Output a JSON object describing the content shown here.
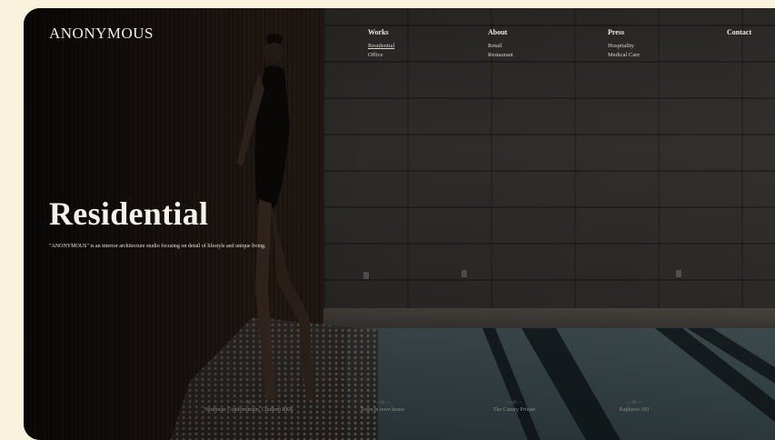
{
  "header": {
    "logo": "ANONYMOUS",
    "nav": [
      {
        "heading": "Works",
        "links": [
          "Residential",
          "Office"
        ],
        "active": 0
      },
      {
        "heading": "About",
        "links": [
          "Retail",
          "Restaurant"
        ]
      },
      {
        "heading": "Press",
        "links": [
          "Hospitality",
          "Medical Care"
        ]
      },
      {
        "heading": "Contact",
        "links": []
      }
    ]
  },
  "hero": {
    "title": "Residential",
    "description": "\"ANONYMOUS\" is an interior architecture studio focusing on detail of lifestyle and unique living."
  },
  "projects": [
    {
      "num": "— 01 —",
      "name": "Neuhouse Condominium, Chidlom BKK"
    },
    {
      "num": "— 02 —",
      "name": "Town in town house"
    },
    {
      "num": "— 03 —",
      "name": "The Canary Private"
    },
    {
      "num": "— 04 —",
      "name": "Rajthavri 183"
    }
  ],
  "colors": {
    "page_background": "#fbf2de",
    "text_light": "#f5f2ec"
  }
}
